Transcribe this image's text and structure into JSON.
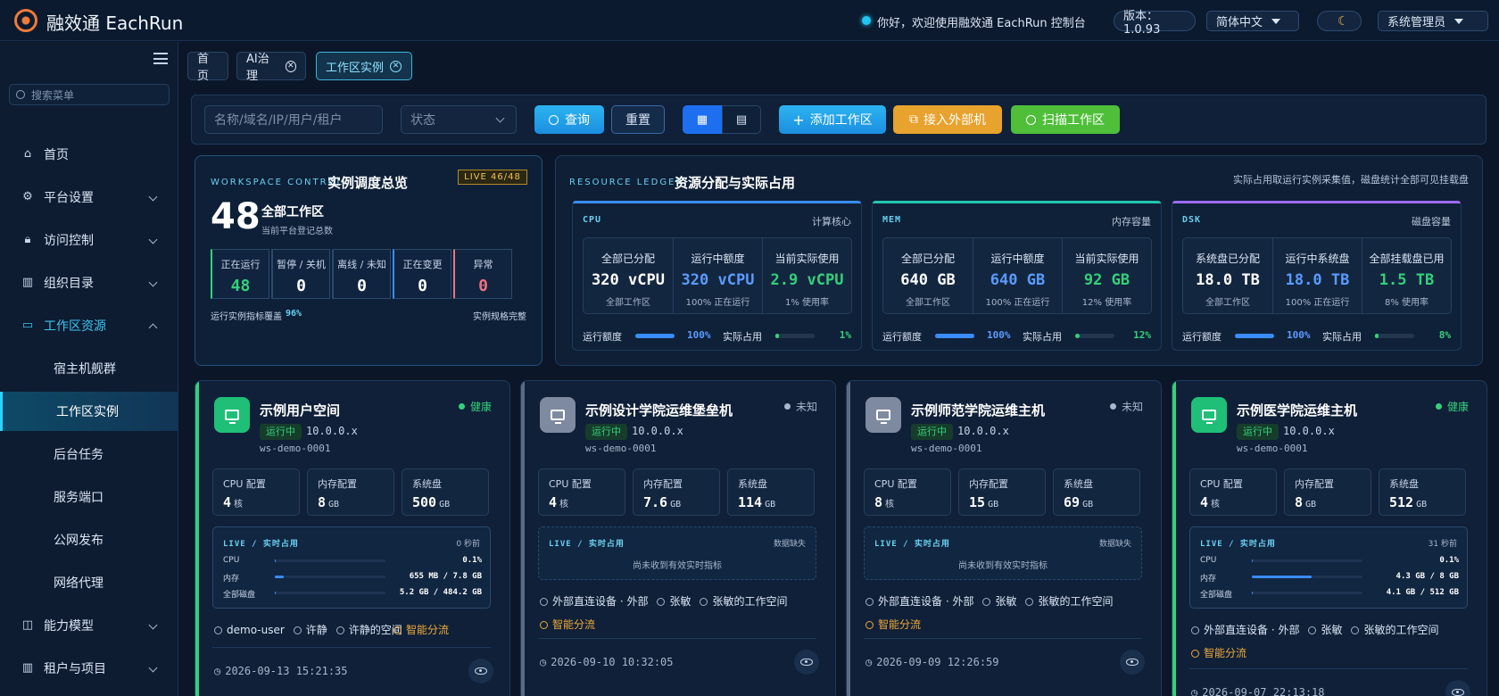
{
  "app": {
    "title": "融效通 EachRun"
  },
  "header": {
    "greeting": "你好，欢迎使用融效通 EachRun 控制台",
    "version": "版本：1.0.93",
    "language": "简体中文",
    "user": "系统管理员"
  },
  "sidebar": {
    "search_placeholder": "搜索菜单",
    "items": [
      {
        "label": "首页",
        "icon": "home-icon"
      },
      {
        "label": "平台设置",
        "icon": "gear-icon"
      },
      {
        "label": "访问控制",
        "icon": "lock-icon"
      },
      {
        "label": "组织目录",
        "icon": "building-icon"
      },
      {
        "label": "工作区资源",
        "icon": "monitor-icon"
      },
      {
        "label": "宿主机舰群"
      },
      {
        "label": "工作区实例"
      },
      {
        "label": "后台任务"
      },
      {
        "label": "服务端口"
      },
      {
        "label": "公网发布"
      },
      {
        "label": "网络代理"
      },
      {
        "label": "能力模型",
        "icon": "chip-icon"
      },
      {
        "label": "租户与项目",
        "icon": "building-icon"
      }
    ]
  },
  "tabs": [
    {
      "label": "首页"
    },
    {
      "label": "AI治理"
    },
    {
      "label": "工作区实例"
    }
  ],
  "toolbar": {
    "search_placeholder": "名称/域名/IP/用户/租户",
    "status_placeholder": "状态",
    "query": "查询",
    "reset": "重置",
    "add": "添加工作区",
    "external": "接入外部机",
    "scan": "扫描工作区"
  },
  "overview": {
    "tag": "WORKSPACE CONTROL",
    "title": "实例调度总览",
    "live": "LIVE 46/48",
    "total": "48",
    "total_label": "全部工作区",
    "total_sub": "当前平台登记总数",
    "stats": [
      {
        "label": "正在运行",
        "value": "48",
        "color": "#35d07a"
      },
      {
        "label": "暂停 / 关机",
        "value": "0",
        "color": "#ffffff"
      },
      {
        "label": "离线 / 未知",
        "value": "0",
        "color": "#ffffff"
      },
      {
        "label": "正在变更",
        "value": "0",
        "color": "#ffffff"
      },
      {
        "label": "异常",
        "value": "0",
        "color": "#f07080"
      }
    ],
    "coverage_label": "运行实例指标覆盖",
    "coverage_value": "96%",
    "spec_status": "实例规格完整"
  },
  "ledger": {
    "tag": "RESOURCE LEDGER",
    "title": "资源分配与实际占用",
    "note": "实际占用取运行实例采集值，磁盘统计全部可见挂载盘",
    "run_quota_label": "运行额度",
    "actual_label": "实际占用",
    "resources": [
      {
        "key": "CPU",
        "name": "计算核心",
        "accent": "#3a8cff",
        "cols": [
          {
            "h": "全部已分配",
            "v": "320 vCPU",
            "s": "全部工作区",
            "c": "#ffffff"
          },
          {
            "h": "运行中额度",
            "v": "320 vCPU",
            "s": "100% 正在运行",
            "c": "#5b9bff"
          },
          {
            "h": "当前实际使用",
            "v": "2.9 vCPU",
            "s": "1% 使用率",
            "c": "#35d07a"
          }
        ],
        "quota_pct": "100%",
        "quota_fraction": 1.0,
        "actual_pct": "1%",
        "actual_fraction": 0.01
      },
      {
        "key": "MEM",
        "name": "内存容量",
        "accent": "#22c5b0",
        "cols": [
          {
            "h": "全部已分配",
            "v": "640 GB",
            "s": "全部工作区",
            "c": "#ffffff"
          },
          {
            "h": "运行中额度",
            "v": "640 GB",
            "s": "100% 正在运行",
            "c": "#5b9bff"
          },
          {
            "h": "当前实际使用",
            "v": "92 GB",
            "s": "12% 使用率",
            "c": "#35d07a"
          }
        ],
        "quota_pct": "100%",
        "quota_fraction": 1.0,
        "actual_pct": "12%",
        "actual_fraction": 0.12
      },
      {
        "key": "DSK",
        "name": "磁盘容量",
        "accent": "#9a6cff",
        "cols": [
          {
            "h": "系统盘已分配",
            "v": "18.0 TB",
            "s": "全部工作区",
            "c": "#ffffff"
          },
          {
            "h": "运行中系统盘",
            "v": "18.0 TB",
            "s": "100% 正在运行",
            "c": "#5b9bff"
          },
          {
            "h": "全部挂载盘已用",
            "v": "1.5 TB",
            "s": "8% 使用率",
            "c": "#35d07a"
          }
        ],
        "quota_pct": "100%",
        "quota_fraction": 1.0,
        "actual_pct": "8%",
        "actual_fraction": 0.08
      }
    ]
  },
  "spec_labels": {
    "cpu": "CPU 配置",
    "mem": "内存配置",
    "disk": "系统盘",
    "core_unit": "核",
    "gb_unit": "GB"
  },
  "live_labels": {
    "title": "LIVE / 实时占用",
    "cpu": "CPU",
    "mem": "内存",
    "disk": "全部磁盘",
    "empty": "尚未收到有效实时指标"
  },
  "cards": [
    {
      "name": "示例用户空间",
      "health": "健康",
      "health_color": "#35d07a",
      "state": "运行中",
      "ip": "10.0.0.x",
      "ws": "ws-demo-0001",
      "cpu": "4",
      "mem": "8",
      "disk": "500",
      "avatar": "#1fbf78",
      "stripe": "#35d07a",
      "live_time": "0 秒前",
      "cpu_v": "0.1%",
      "cpu_f": 0.01,
      "mem_v": "655 MB / 7.8 GB",
      "mem_f": 0.08,
      "disk_v": "5.2 GB / 484.2 GB",
      "disk_f": 0.01,
      "meta1": [
        "demo-user",
        "许静",
        "许静的空间"
      ],
      "meta_tag": "智能分流",
      "time": "2026-09-13 15:21:35"
    },
    {
      "name": "示例设计学院运维堡垒机",
      "health": "未知",
      "health_color": "#a7b7cc",
      "state": "运行中",
      "ip": "10.0.0.x",
      "ws": "ws-demo-0001",
      "cpu": "4",
      "mem": "7.6",
      "disk": "114",
      "avatar": "#7e8aa0",
      "stripe": "#5b6b82",
      "live_time": "数据缺失",
      "meta1": [
        "外部直连设备 · 外部",
        "张敏",
        "张敏的工作空间"
      ],
      "meta_tag": "智能分流",
      "time": "2026-09-10 10:32:05"
    },
    {
      "name": "示例师范学院运维主机",
      "health": "未知",
      "health_color": "#a7b7cc",
      "state": "运行中",
      "ip": "10.0.0.x",
      "ws": "ws-demo-0001",
      "cpu": "8",
      "mem": "15",
      "disk": "69",
      "avatar": "#7e8aa0",
      "stripe": "#5b6b82",
      "live_time": "数据缺失",
      "meta1": [
        "外部直连设备 · 外部",
        "张敏",
        "张敏的工作空间"
      ],
      "meta_tag": "智能分流",
      "time": "2026-09-09 12:26:59"
    },
    {
      "name": "示例医学院运维主机",
      "health": "健康",
      "health_color": "#35d07a",
      "state": "运行中",
      "ip": "10.0.0.x",
      "ws": "ws-demo-0001",
      "cpu": "4",
      "mem": "8",
      "disk": "512",
      "avatar": "#1fbf78",
      "stripe": "#35d07a",
      "live_time": "31 秒前",
      "cpu_v": "0.1%",
      "cpu_f": 0.01,
      "mem_v": "4.3 GB / 8 GB",
      "mem_f": 0.54,
      "disk_v": "4.1 GB / 512 GB",
      "disk_f": 0.01,
      "meta1": [
        "外部直连设备 · 外部",
        "张敏",
        "张敏的工作空间"
      ],
      "meta_tag": "智能分流",
      "time": "2026-09-07 22:13:18"
    }
  ]
}
